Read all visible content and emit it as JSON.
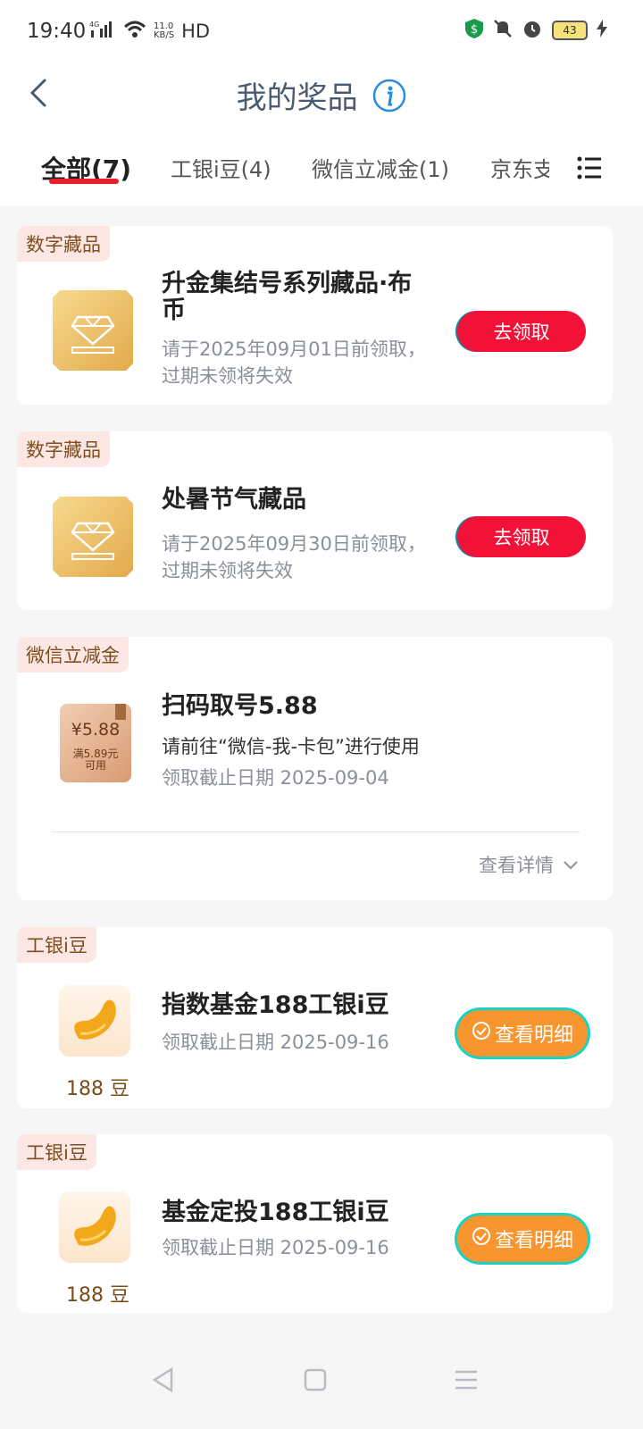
{
  "status_bar": {
    "time": "19:40",
    "network_type": "4G",
    "speed_value": "11.0",
    "speed_unit": "KB/S",
    "hd_label": "HD",
    "battery": "43"
  },
  "header": {
    "title": "我的奖品"
  },
  "tabs": [
    {
      "label": "全部(7)",
      "active": true
    },
    {
      "label": "工银i豆(4)",
      "active": false
    },
    {
      "label": "微信立减金(1)",
      "active": false
    },
    {
      "label": "京东支",
      "active": false
    }
  ],
  "cards": [
    {
      "badge": "数字藏品",
      "title_line1": "升金集结号系列藏品·布",
      "title_line2": "币",
      "sub_line1": "请于2025年09月01日前领取，",
      "sub_line2": "过期未领将失效",
      "button": "去领取"
    },
    {
      "badge": "数字藏品",
      "title_line1": "处暑节气藏品",
      "sub_line1": "请于2025年09月30日前领取，",
      "sub_line2": "过期未领将失效",
      "button": "去领取"
    },
    {
      "badge": "微信立减金",
      "title_line1": "扫码取号5.88",
      "desc": "请前往“微信-我-卡包”进行使用",
      "sub_line1": "领取截止日期 2025-09-04",
      "coupon_amount": "¥5.88",
      "coupon_cond_line1": "满5.89元",
      "coupon_cond_line2": "可用",
      "details_label": "查看详情"
    },
    {
      "badge": "工银i豆",
      "title_line1": "指数基金188工银i豆",
      "sub_line1": "领取截止日期 2025-09-16",
      "beans": "188 豆",
      "button": "查看明细"
    },
    {
      "badge": "工银i豆",
      "title_line1": "基金定投188工银i豆",
      "sub_line1": "领取截止日期 2025-09-16",
      "beans": "188 豆",
      "button": "查看明细"
    }
  ],
  "colors": {
    "accent_red": "#f21238",
    "accent_orange": "#f7952e",
    "tab_underline": "#e8202c"
  }
}
